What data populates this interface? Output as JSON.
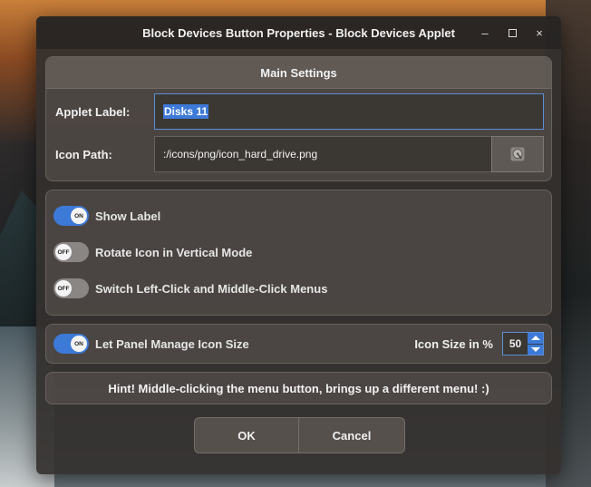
{
  "window": {
    "title": "Block Devices Button Properties - Block Devices Applet",
    "controls": {
      "minimize": "–",
      "close": "×"
    }
  },
  "main_settings": {
    "header": "Main Settings",
    "applet_label": {
      "label": "Applet Label:",
      "value": "Disks 11"
    },
    "icon_path": {
      "label": "Icon Path:",
      "value": ":/icons/png/icon_hard_drive.png",
      "button_icon": "hard-drive-icon"
    }
  },
  "toggles": [
    {
      "label": "Show Label",
      "state": "ON",
      "on": true
    },
    {
      "label": "Rotate Icon in Vertical Mode",
      "state": "OFF",
      "on": false
    },
    {
      "label": "Switch Left-Click and Middle-Click Menus",
      "state": "OFF",
      "on": false
    }
  ],
  "icon_size": {
    "toggle": {
      "label": "Let Panel Manage Icon Size",
      "state": "ON",
      "on": true
    },
    "size_label": "Icon Size in %",
    "size_value": "50"
  },
  "hint": "Hint! Middle-clicking the menu button, brings up a different menu! :)",
  "buttons": {
    "ok": "OK",
    "cancel": "Cancel"
  },
  "colors": {
    "accent": "#3d7ad8",
    "focus_border": "#5b8fd6"
  }
}
